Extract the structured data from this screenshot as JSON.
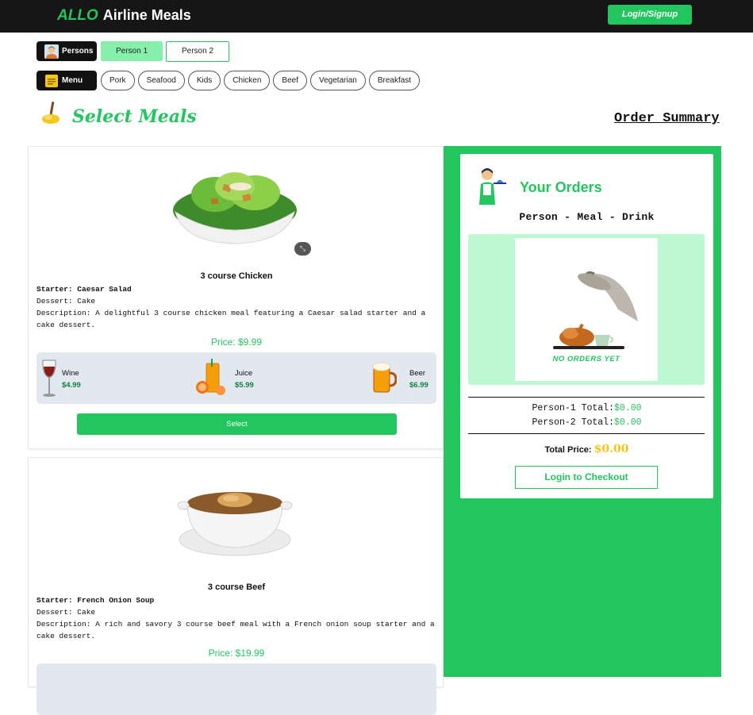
{
  "header": {
    "brand_prefix": "ALLO",
    "brand_name": "Airline Meals",
    "login_label": "Login/Signup"
  },
  "persons": {
    "label": "Persons",
    "icon": "person-avatar-icon",
    "tabs": [
      {
        "label": "Person 1",
        "active": true
      },
      {
        "label": "Person 2",
        "active": false
      }
    ]
  },
  "menu": {
    "label": "Menu",
    "icon": "menu-book-icon",
    "filters": [
      "Pork",
      "Seafood",
      "Kids",
      "Chicken",
      "Beef",
      "Vegetarian",
      "Breakfast"
    ]
  },
  "section": {
    "title": "Select Meals",
    "order_summary": "Order Summary"
  },
  "meals": [
    {
      "name": "3 course Chicken",
      "starter": "Starter: Caesar Salad",
      "dessert": "Dessert: Cake",
      "description": "Description: A delightful 3 course chicken meal featuring a Caesar salad starter and a cake dessert.",
      "price": "Price: $9.99",
      "image": "caesar-salad-image",
      "drinks": [
        {
          "name": "Wine",
          "price": "$4.99",
          "icon": "wine-glass-icon"
        },
        {
          "name": "Juice",
          "price": "$5.99",
          "icon": "orange-juice-icon"
        },
        {
          "name": "Beer",
          "price": "$6.99",
          "icon": "beer-mug-icon"
        }
      ],
      "select_label": "Select"
    },
    {
      "name": "3 course Beef",
      "starter": "Starter: French Onion Soup",
      "dessert": "Dessert: Cake",
      "description": "Description: A rich and savory 3 course beef meal with a French onion soup starter and a cake dessert.",
      "price": "Price: $19.99",
      "image": "french-onion-soup-image"
    }
  ],
  "orders": {
    "title": "Your Orders",
    "columns": "Person - Meal - Drink",
    "empty_text": "NO ORDERS YET",
    "person1_label": "Person-1 Total:",
    "person1_total": "$0.00",
    "person2_label": "Person-2 Total:",
    "person2_total": "$0.00",
    "total_label": "Total Price:",
    "total_value": "$0.00",
    "checkout_label": "Login to Checkout"
  },
  "colors": {
    "accent": "#22c55e",
    "accent_light": "#86efac",
    "header_bg": "#161616",
    "total_gold": "#f5c518"
  }
}
